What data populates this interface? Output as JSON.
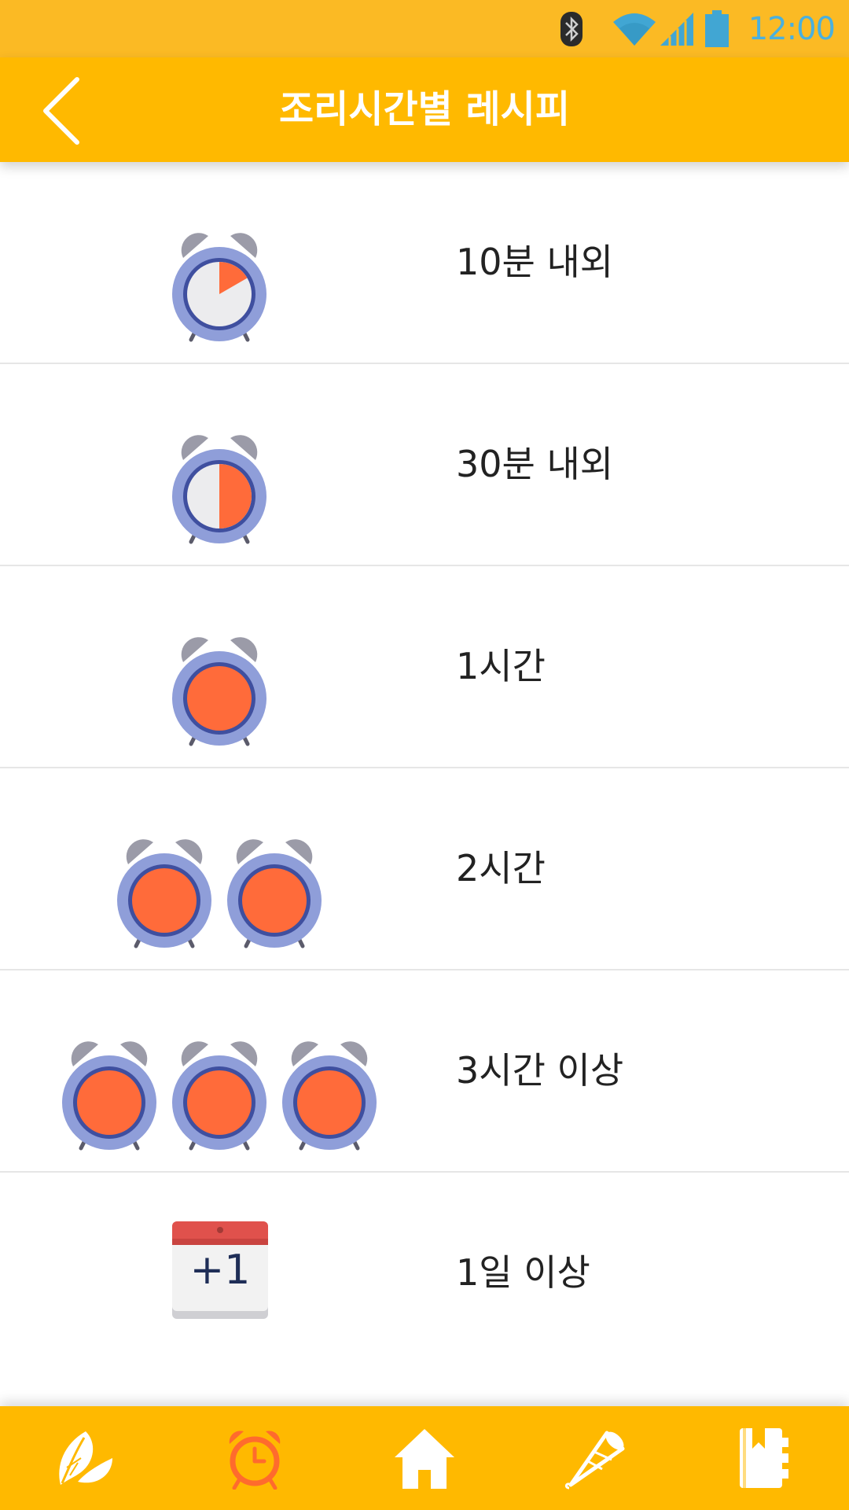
{
  "status_bar": {
    "time": "12:00",
    "icons": [
      "bluetooth-icon",
      "wifi-icon",
      "cell-signal-icon",
      "battery-icon"
    ]
  },
  "header": {
    "title": "조리시간별 레시피",
    "back_icon": "chevron-left-icon"
  },
  "list": {
    "items": [
      {
        "label": "10분 내외",
        "icon": "alarm-clock-sixth-icon"
      },
      {
        "label": "30분 내외",
        "icon": "alarm-clock-half-icon"
      },
      {
        "label": "1시간",
        "icon": "alarm-clock-full-icon"
      },
      {
        "label": "2시간",
        "icon": "two-alarm-clocks-icon"
      },
      {
        "label": "3시간 이상",
        "icon": "three-alarm-clocks-icon"
      },
      {
        "label": "1일 이상",
        "icon": "calendar-plus-one-icon",
        "badge": "+1"
      }
    ]
  },
  "bottom_nav": {
    "items": [
      {
        "icon": "leaf-icon",
        "active": false
      },
      {
        "icon": "alarm-clock-icon",
        "active": true
      },
      {
        "icon": "home-icon",
        "active": false
      },
      {
        "icon": "party-horn-icon",
        "active": false
      },
      {
        "icon": "notebook-icon",
        "active": false
      }
    ]
  },
  "colors": {
    "status_bar": "#FBBA24",
    "app_bar": "#FFB900",
    "clock_face_fill": "#FF6B3A",
    "clock_rim": "#8F9ED9",
    "nav_active": "#FF6B2D"
  }
}
